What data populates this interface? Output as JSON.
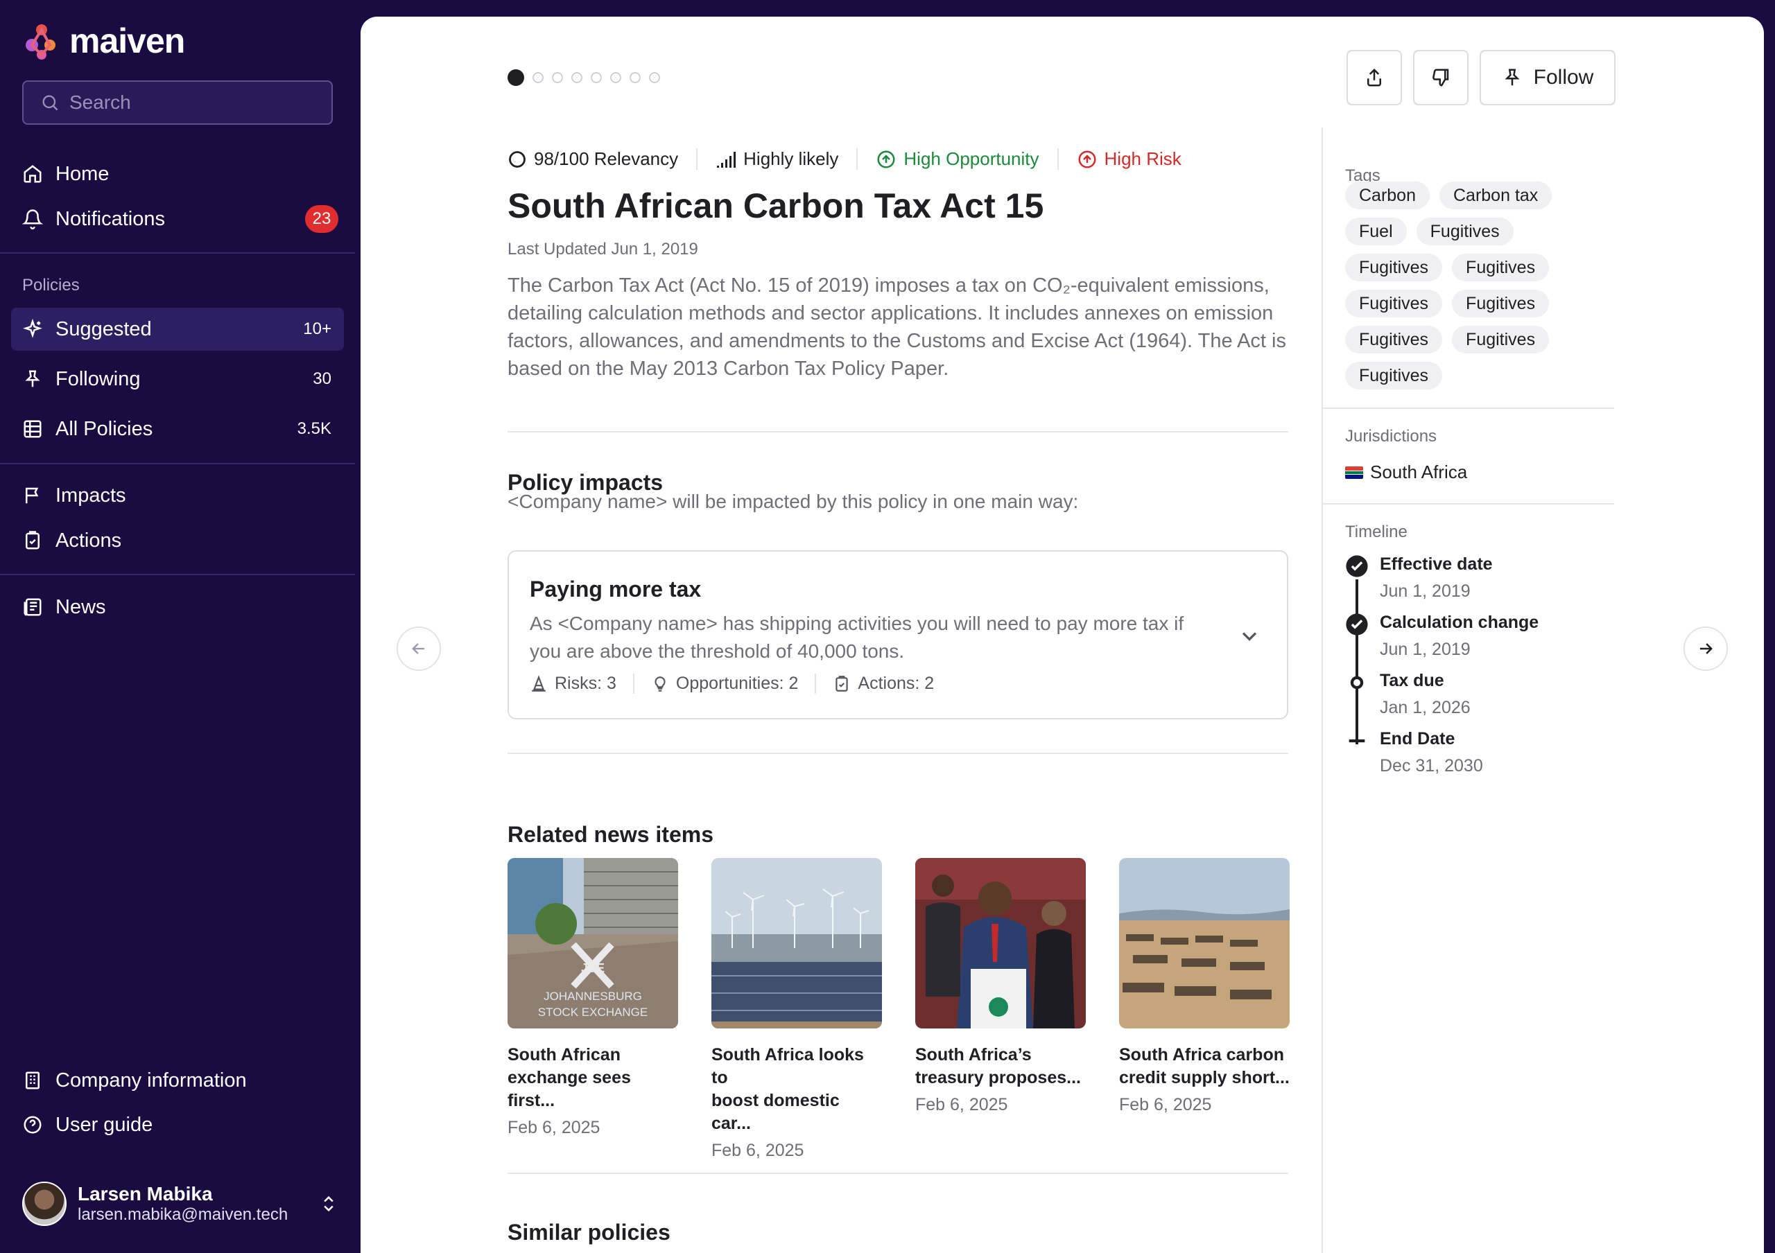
{
  "app": {
    "name": "maiven"
  },
  "search": {
    "placeholder": "Search"
  },
  "nav": {
    "home": "Home",
    "notifications": "Notifications",
    "notifications_count": "23",
    "policies_label": "Policies",
    "suggested": "Suggested",
    "suggested_count": "10+",
    "following": "Following",
    "following_count": "30",
    "all_policies": "All Policies",
    "all_policies_count": "3.5K",
    "impacts": "Impacts",
    "actions": "Actions",
    "news": "News",
    "company_info": "Company information",
    "user_guide": "User guide"
  },
  "user": {
    "name": "Larsen Mabika",
    "email": "larsen.mabika@maiven.tech"
  },
  "toolbar": {
    "follow_label": "Follow"
  },
  "policy": {
    "relevancy": "98/100 Relevancy",
    "likelihood": "Highly likely",
    "opportunity": "High Opportunity",
    "risk": "High Risk",
    "title": "South African Carbon Tax Act 15",
    "last_updated": "Last Updated Jun 1, 2019",
    "description": "The Carbon Tax Act (Act No. 15 of 2019) imposes a tax on CO₂-equivalent emissions, detailing calculation methods and sector applications. It includes annexes on emission factors, allowances, and amendments to the Customs and Excise Act (1964). The Act is based on the May 2013 Carbon Tax Policy Paper."
  },
  "impacts": {
    "heading": "Policy impacts",
    "subtitle": "<Company name> will be impacted by this policy in one main way:",
    "card": {
      "title": "Paying more tax",
      "description": "As <Company name> has shipping activities you will need to pay more tax if you are above the threshold of 40,000 tons.",
      "risks": "Risks: 3",
      "opportunities": "Opportunities: 2",
      "actions": "Actions: 2"
    }
  },
  "news": {
    "heading": "Related news items",
    "items": [
      {
        "title_line1": "South African",
        "title_line2": "exchange sees first...",
        "date": "Feb 6, 2025",
        "image_text_1": "JSE",
        "image_text_2": "JOHANNESBURG",
        "image_text_3": "STOCK EXCHANGE"
      },
      {
        "title_line1": "South Africa looks to",
        "title_line2": "boost domestic car...",
        "date": "Feb 6, 2025"
      },
      {
        "title_line1": "South Africa’s",
        "title_line2": "treasury proposes...",
        "date": "Feb 6, 2025"
      },
      {
        "title_line1": "South Africa carbon",
        "title_line2": "credit supply short...",
        "date": "Feb 6, 2025"
      }
    ]
  },
  "similar": {
    "heading": "Similar policies"
  },
  "rail": {
    "tags_label": "Tags",
    "tags": [
      "Carbon",
      "Carbon tax",
      "Fuel",
      "Fugitives",
      "Fugitives",
      "Fugitives",
      "Fugitives",
      "Fugitives",
      "Fugitives",
      "Fugitives",
      "Fugitives"
    ],
    "jurisdictions_label": "Jurisdictions",
    "jurisdiction": "South Africa",
    "timeline_label": "Timeline",
    "timeline": [
      {
        "title": "Effective date",
        "date": "Jun 1, 2019"
      },
      {
        "title": "Calculation change",
        "date": "Jun 1, 2019"
      },
      {
        "title": "Tax due",
        "date": "Jan 1, 2026"
      },
      {
        "title": "End Date",
        "date": "Dec 31, 2030"
      }
    ]
  },
  "colors": {
    "sidebar_bg": "#1a0b40",
    "badge": "#e02d2d",
    "opportunity": "#1a8a3a",
    "risk": "#d12a2a"
  }
}
